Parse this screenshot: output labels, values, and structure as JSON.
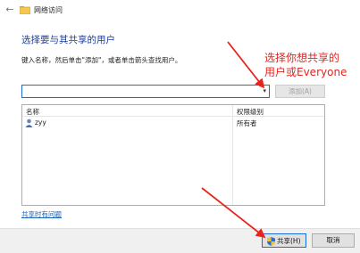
{
  "window": {
    "title": "网络访问",
    "icons": {
      "back": "back-arrow-icon",
      "title": "network-folder-icon"
    }
  },
  "heading": "选择要与其共享的用户",
  "instruction": "键入名称，然后单击\"添加\"，或者单击箭头查找用户。",
  "user_input": {
    "value": "",
    "placeholder": ""
  },
  "add_button": "添加(A)",
  "list": {
    "columns": [
      "名称",
      "权限级别"
    ],
    "rows": [
      {
        "name": "zyy",
        "permission": "所有者",
        "icon": "user-icon"
      }
    ]
  },
  "help_link": "共享时有问题",
  "buttons": {
    "share": "共享(H)",
    "cancel": "取消"
  },
  "annotation": {
    "line1": "选择你想共享的",
    "line2": "用户或Everyone"
  },
  "colors": {
    "heading": "#1a3e9a",
    "annotation": "#e8231d",
    "focus_border": "#1a6fd0",
    "link": "#1a5fb4"
  }
}
